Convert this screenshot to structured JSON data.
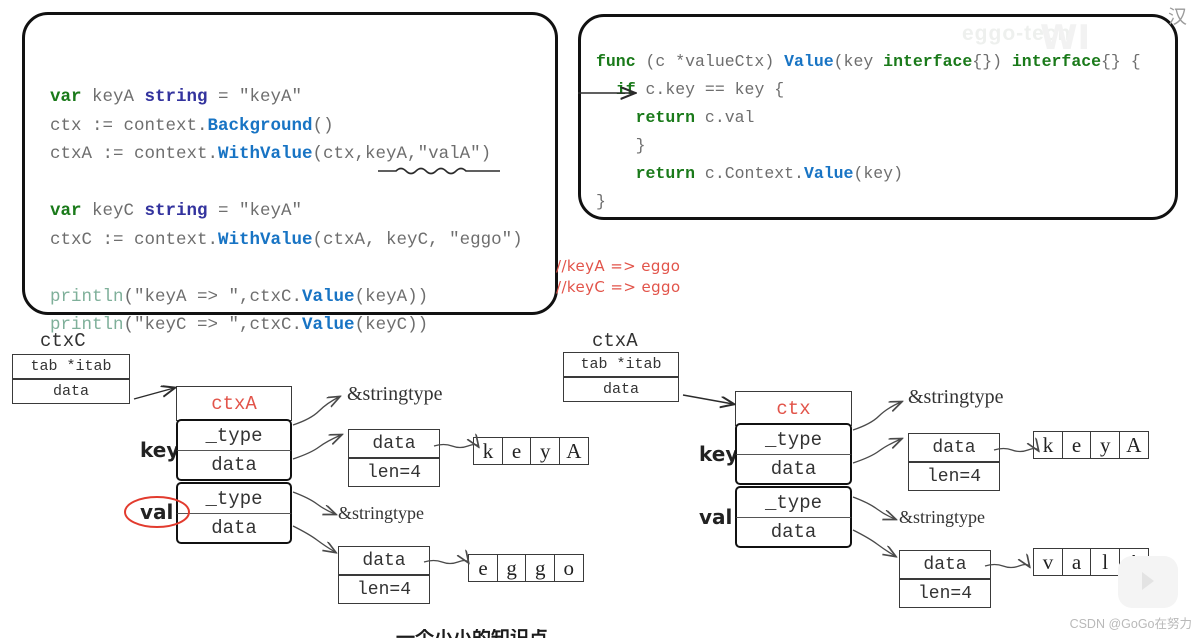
{
  "code_left": {
    "lines": [
      [
        {
          "t": "var",
          "c": "kw"
        },
        {
          "t": " keyA ",
          "c": "pn"
        },
        {
          "t": "string",
          "c": "ty"
        },
        {
          "t": " = \"keyA\"",
          "c": "pn"
        }
      ],
      [
        {
          "t": "ctx := context.",
          "c": "pn"
        },
        {
          "t": "Background",
          "c": "fn"
        },
        {
          "t": "()",
          "c": "pn"
        }
      ],
      [
        {
          "t": "ctxA := context.",
          "c": "pn"
        },
        {
          "t": "WithValue",
          "c": "fn"
        },
        {
          "t": "(ctx,keyA,\"valA\")",
          "c": "pn"
        }
      ],
      [
        {
          "t": "",
          "c": "pn"
        }
      ],
      [
        {
          "t": "var",
          "c": "kw"
        },
        {
          "t": " keyC ",
          "c": "pn"
        },
        {
          "t": "string",
          "c": "ty"
        },
        {
          "t": " = \"keyA\"",
          "c": "pn"
        }
      ],
      [
        {
          "t": "ctxC := context.",
          "c": "pn"
        },
        {
          "t": "WithValue",
          "c": "fn"
        },
        {
          "t": "(ctxA, keyC, \"eggo\")",
          "c": "pn"
        }
      ],
      [
        {
          "t": "",
          "c": "pn"
        }
      ],
      [
        {
          "t": "println",
          "c": "pl"
        },
        {
          "t": "(\"keyA => \",ctxC.",
          "c": "pn"
        },
        {
          "t": "Value",
          "c": "fn"
        },
        {
          "t": "(keyA))",
          "c": "pn"
        }
      ],
      [
        {
          "t": "println",
          "c": "pl"
        },
        {
          "t": "(\"keyC => \",ctxC.",
          "c": "pn"
        },
        {
          "t": "Value",
          "c": "fn"
        },
        {
          "t": "(keyC))",
          "c": "pn"
        }
      ]
    ]
  },
  "code_right": {
    "lines": [
      [
        {
          "t": "func",
          "c": "kw"
        },
        {
          "t": " (c *valueCtx) ",
          "c": "pn"
        },
        {
          "t": "Value",
          "c": "fn"
        },
        {
          "t": "(key ",
          "c": "pn"
        },
        {
          "t": "interface",
          "c": "kw"
        },
        {
          "t": "{}) ",
          "c": "pn"
        },
        {
          "t": "interface",
          "c": "kw"
        },
        {
          "t": "{} {",
          "c": "pn"
        }
      ],
      [
        {
          "t": "  ",
          "c": "pn"
        },
        {
          "t": "if",
          "c": "kw"
        },
        {
          "t": " c.key == key {",
          "c": "pn"
        }
      ],
      [
        {
          "t": "    ",
          "c": "pn"
        },
        {
          "t": "return",
          "c": "kw"
        },
        {
          "t": " c.val",
          "c": "pn"
        }
      ],
      [
        {
          "t": "    }",
          "c": "pn"
        }
      ],
      [
        {
          "t": "    ",
          "c": "pn"
        },
        {
          "t": "return",
          "c": "kw"
        },
        {
          "t": " c.Context.",
          "c": "pn"
        },
        {
          "t": "Value",
          "c": "fn"
        },
        {
          "t": "(key)",
          "c": "pn"
        }
      ],
      [
        {
          "t": "}",
          "c": "pn"
        }
      ]
    ]
  },
  "comments": {
    "line1": "//keyA => eggo",
    "line2": "//keyC => eggo"
  },
  "diagram_left": {
    "title": "ctxC",
    "iface": {
      "row1": "tab *itab",
      "row2": "data"
    },
    "struct_title": "ctxA",
    "key_label": "key",
    "val_label": "val",
    "key_fields": {
      "type": "_type",
      "data": "data"
    },
    "val_fields": {
      "type": "_type",
      "data": "data"
    },
    "key_stringtype": "&stringtype",
    "val_stringtype": "&stringtype",
    "key_slice": {
      "data": "data",
      "len": "len=4"
    },
    "val_slice": {
      "data": "data",
      "len": "len=4"
    },
    "key_chars": [
      "k",
      "e",
      "y",
      "A"
    ],
    "val_chars": [
      "e",
      "g",
      "g",
      "o"
    ]
  },
  "diagram_right": {
    "title": "ctxA",
    "iface": {
      "row1": "tab *itab",
      "row2": "data"
    },
    "struct_title": "ctx",
    "key_label": "key",
    "val_label": "val",
    "key_fields": {
      "type": "_type",
      "data": "data"
    },
    "val_fields": {
      "type": "_type",
      "data": "data"
    },
    "key_stringtype": "&stringtype",
    "val_stringtype": "&stringtype",
    "key_slice": {
      "data": "data",
      "len": "len=4"
    },
    "val_slice": {
      "data": "data",
      "len": "len=4"
    },
    "key_chars": [
      "k",
      "e",
      "y",
      "A"
    ],
    "val_chars": [
      "v",
      "a",
      "l",
      "A"
    ]
  },
  "watermarks": {
    "csdn": "CSDN @GoGo在努力",
    "top_text": "eggo-tech",
    "corner": "汉",
    "logo": "WI",
    "bottom_strip": "一个小小的知识点"
  },
  "colors": {
    "keyword": "#1a7a1a",
    "type": "#33339e",
    "function": "#1874c4",
    "plain": "#6e6e6e",
    "println": "#7fb09a",
    "comment_red": "#e2544a",
    "struct_title_red": "#e2544a",
    "border": "#111111"
  }
}
